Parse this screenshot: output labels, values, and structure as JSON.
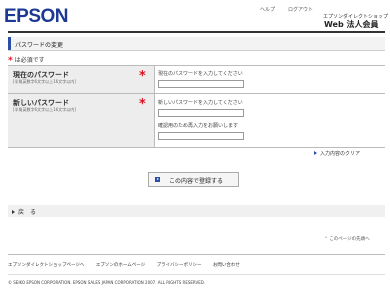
{
  "header": {
    "logo": "EPSON",
    "help": "ヘルプ",
    "logout": "ログアウト",
    "shop_name": "エプソンダイレクトショップ",
    "shop_sub": "Web 法人会員"
  },
  "section_title": "パスワードの変更",
  "required_note": "は必須です",
  "form": {
    "current": {
      "label": "現在のパスワード",
      "note": "[半角英数字6文字以上16文字以内]",
      "hint": "現在のパスワードを入力してください",
      "value": ""
    },
    "new": {
      "label": "新しいパスワード",
      "note": "[半角英数字6文字以上16文字以内]",
      "hint": "新しいパスワードを入力してください",
      "confirm_hint": "確認用のため再入力をお願いします",
      "value": "",
      "confirm_value": ""
    },
    "clear": "入力内容のクリア",
    "submit": "この内容で登録する"
  },
  "back": "戻　る",
  "page_top": "このページの先頭へ",
  "footer": {
    "links": [
      "エプソンダイレクトショップページへ",
      "エプソンのホームページ",
      "プライバシーポリシー",
      "お問い合わせ"
    ],
    "copyright": "© SEIKO EPSON CORPORATION. EPSON SALES JAPAN CORPORATION 2007. ALL RIGHTS RESERVED."
  },
  "colors": {
    "brand": "#1c3a94",
    "accent": "#2c4fa5",
    "required": "#dd1122"
  }
}
